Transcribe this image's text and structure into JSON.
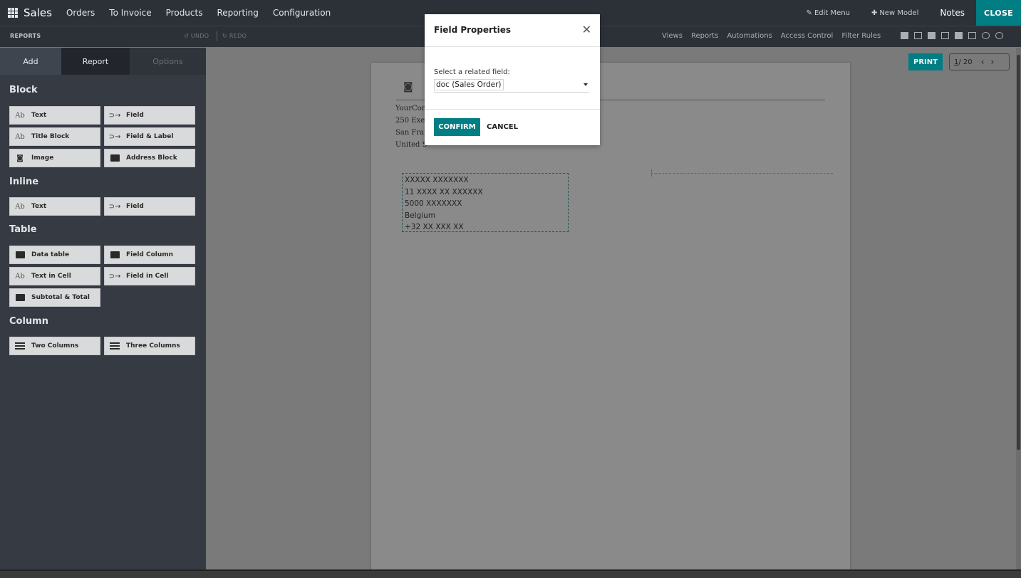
{
  "topnav": {
    "brand": "Sales",
    "links": [
      "Orders",
      "To Invoice",
      "Products",
      "Reporting",
      "Configuration"
    ],
    "edit_menu": "Edit Menu",
    "new_model": "New Model",
    "notes": "Notes",
    "close": "CLOSE"
  },
  "toolbar": {
    "reports": "REPORTS",
    "undo": "UNDO",
    "redo": "REDO",
    "links": [
      "Views",
      "Reports",
      "Automations",
      "Access Control",
      "Filter Rules"
    ]
  },
  "sidebar": {
    "tabs": [
      "Add",
      "Report",
      "Options"
    ],
    "sections": {
      "block": "Block",
      "inline": "Inline",
      "table": "Table",
      "column": "Column"
    },
    "block_items": [
      "Text",
      "Field",
      "Title Block",
      "Field & Label",
      "Image",
      "Address Block"
    ],
    "inline_items": [
      "Text",
      "Field"
    ],
    "table_items": [
      "Data table",
      "Field Column",
      "Text in Cell",
      "Field in Cell",
      "Subtotal & Total"
    ],
    "column_items": [
      "Two Columns",
      "Three Columns"
    ],
    "ab_glyph": "Ab"
  },
  "report": {
    "company_lines": [
      "YourCor",
      "250 Exe",
      "San Fran",
      "United S"
    ],
    "address_lines": [
      "XXXXX XXXXXXX",
      "11 XXXX XX XXXXXX",
      "5000 XXXXXXX",
      "Belgium",
      "+32 XX XXX  XX"
    ]
  },
  "pager": {
    "print": "PRINT",
    "current": "1",
    "total": "/ 20"
  },
  "modal": {
    "title": "Field Properties",
    "label": "Select a related field:",
    "selected": "doc (Sales Order)",
    "confirm": "CONFIRM",
    "cancel": "CANCEL"
  },
  "colors": {
    "accent": "#017e84",
    "nav_bg": "#2c3138",
    "sidebar_bg": "#363b43"
  }
}
